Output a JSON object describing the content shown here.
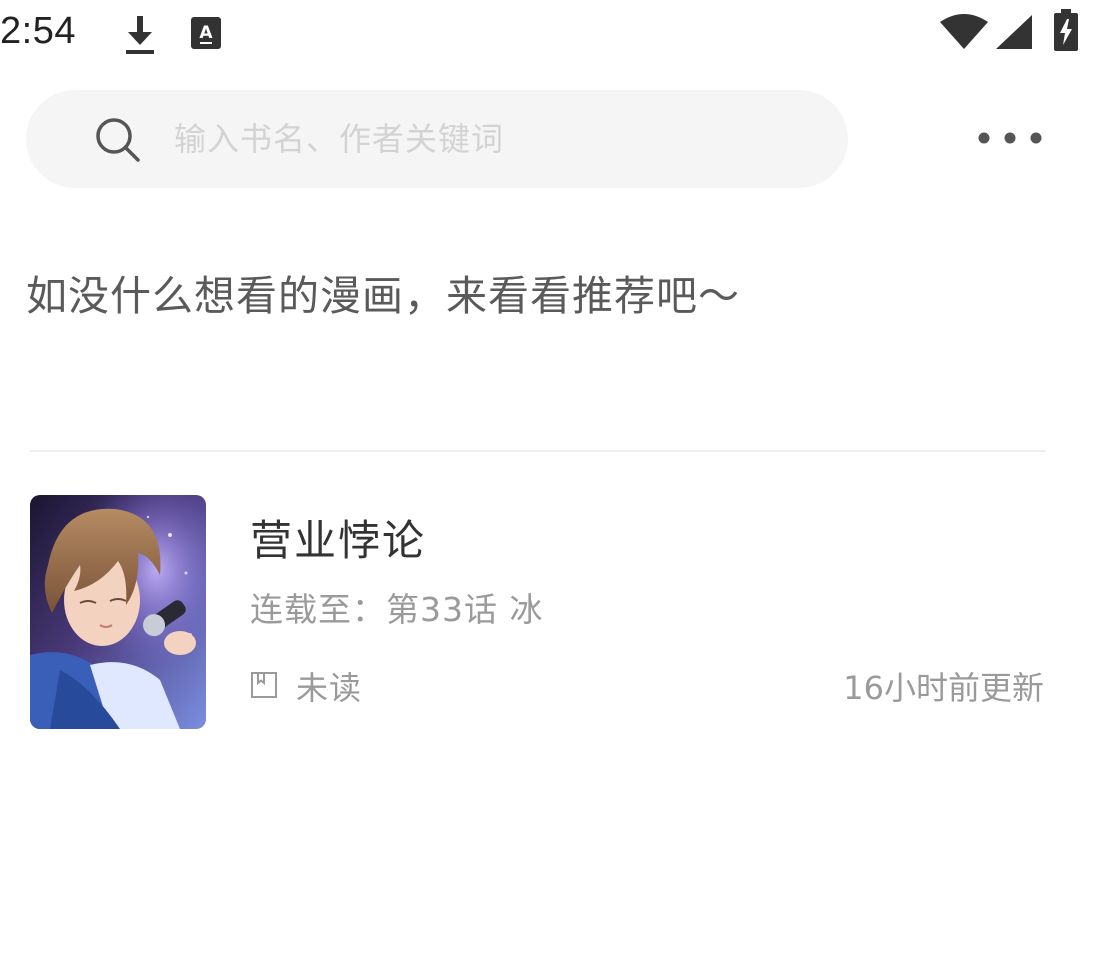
{
  "status_bar": {
    "time": "2:54",
    "icons": [
      "download-icon",
      "keyboard-a-icon",
      "wifi-icon",
      "signal-icon",
      "battery-charging-icon"
    ]
  },
  "search": {
    "placeholder": "输入书名、作者关键词",
    "icon": "search-icon"
  },
  "toolbar": {
    "more_icon": "more-horizontal-icon"
  },
  "hint": {
    "text": "如没什么想看的漫画，来看看推荐吧～"
  },
  "book": {
    "title": "营业悖论",
    "progress": "连载至：第33话 冰",
    "read_status": "未读",
    "updated": "16小时前更新"
  },
  "colors": {
    "search_bg": "#f5f5f5",
    "placeholder": "#d3d3d3",
    "secondary_text": "#9a9a9a",
    "primary_text": "#333333"
  }
}
